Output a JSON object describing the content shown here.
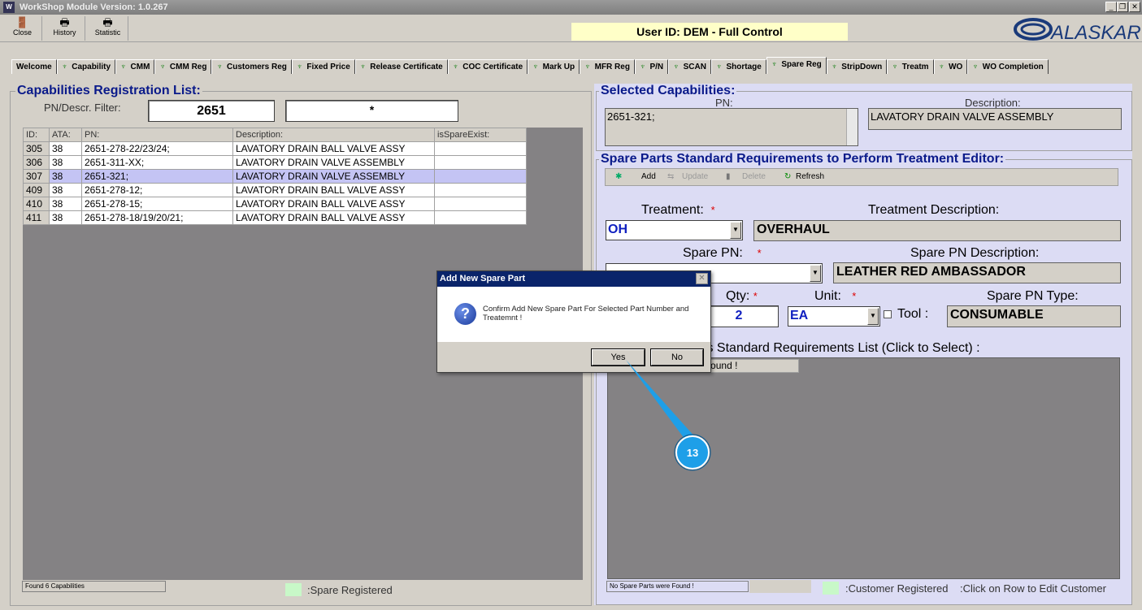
{
  "window": {
    "title": "WorkShop Module  Version: 1.0.267"
  },
  "toolbar": [
    {
      "label": "Close",
      "icon": "door-exit-icon"
    },
    {
      "label": "History",
      "icon": "printer-icon"
    },
    {
      "label": "Statistic",
      "icon": "printer-icon"
    }
  ],
  "user_id": "User ID: DEM - Full Control",
  "logo": "ALASKAR",
  "tabs": [
    "Welcome",
    "Capability",
    "CMM",
    "CMM Reg",
    "Customers Reg",
    "Fixed Price",
    "Release Certificate",
    "COC Certificate",
    "Mark Up",
    "MFR Reg",
    "P/N",
    "SCAN",
    "Shortage",
    "Spare Reg",
    "StripDown",
    "Treatm",
    "WO",
    "WO Completion"
  ],
  "active_tab": "Spare Reg",
  "left": {
    "title": "Capabilities Registration List:",
    "filter_label": "PN/Descr. Filter:",
    "filter_value": "2651",
    "filter_value2": "*",
    "columns": [
      "ID:",
      "ATA:",
      "PN:",
      "Description:",
      "isSpareExist:"
    ],
    "rows": [
      [
        "305",
        "38",
        "2651-278-22/23/24;",
        "LAVATORY DRAIN BALL VALVE ASSY",
        ""
      ],
      [
        "306",
        "38",
        "2651-311-XX;",
        "LAVATORY DRAIN VALVE ASSEMBLY",
        ""
      ],
      [
        "307",
        "38",
        "2651-321;",
        "LAVATORY DRAIN VALVE ASSEMBLY",
        ""
      ],
      [
        "409",
        "38",
        "2651-278-12;",
        "LAVATORY DRAIN BALL VALVE ASSY",
        ""
      ],
      [
        "410",
        "38",
        "2651-278-15;",
        "LAVATORY DRAIN BALL VALVE ASSY",
        ""
      ],
      [
        "411",
        "38",
        "2651-278-18/19/20/21;",
        "LAVATORY DRAIN BALL VALVE ASSY",
        ""
      ]
    ],
    "selected_row": 2,
    "status": "Found 6 Capabilities",
    "legend": ":Spare Registered"
  },
  "selected": {
    "title": "Selected Capabilities:",
    "pn_label": "PN:",
    "pn_value": "2651-321;",
    "desc_label": "Description:",
    "desc_value": "LAVATORY DRAIN VALVE ASSEMBLY"
  },
  "editor": {
    "title": "Spare Parts Standard Requirements to Perform Treatment Editor:",
    "toolbar": {
      "add": "Add",
      "update": "Update",
      "delete": "Delete",
      "refresh": "Refresh"
    },
    "treatment_label": "Treatment:",
    "treatment_value": "OH",
    "treatment_desc_label": "Treatment Description:",
    "treatment_desc_value": "OVERHAUL",
    "spare_pn_label": "Spare PN:",
    "spare_pn_desc_label": "Spare PN Description:",
    "spare_pn_desc_value": "LEATHER RED AMBASSADOR",
    "qty_label": "Qty:",
    "qty_value": "2",
    "unit_label": "Unit:",
    "unit_value": "EA",
    "tool_label": "Tool :",
    "type_label": "Spare PN Type:",
    "type_value": "CONSUMABLE",
    "list_title": "Spare Parts Standard Requirements List (Click to Select) :",
    "list_empty": "No Spare Parts were Found !",
    "status": "No Spare Parts were Found !",
    "legend1": ":Customer Registered",
    "legend2": ":Click on Row to Edit Customer"
  },
  "dialog": {
    "title": "Add New Spare Part",
    "message": "Confirm Add New Spare Part For Selected Part Number and Treatemnt !",
    "yes": "Yes",
    "no": "No"
  },
  "callout": {
    "number": "13",
    "color": "#1e9fe8"
  },
  "colors": {
    "legend_green": "#c8f8c8",
    "selected_row": "#c4c4f4",
    "panel_right": "#dcdcf4",
    "title_blue": "#0a1a8a"
  }
}
